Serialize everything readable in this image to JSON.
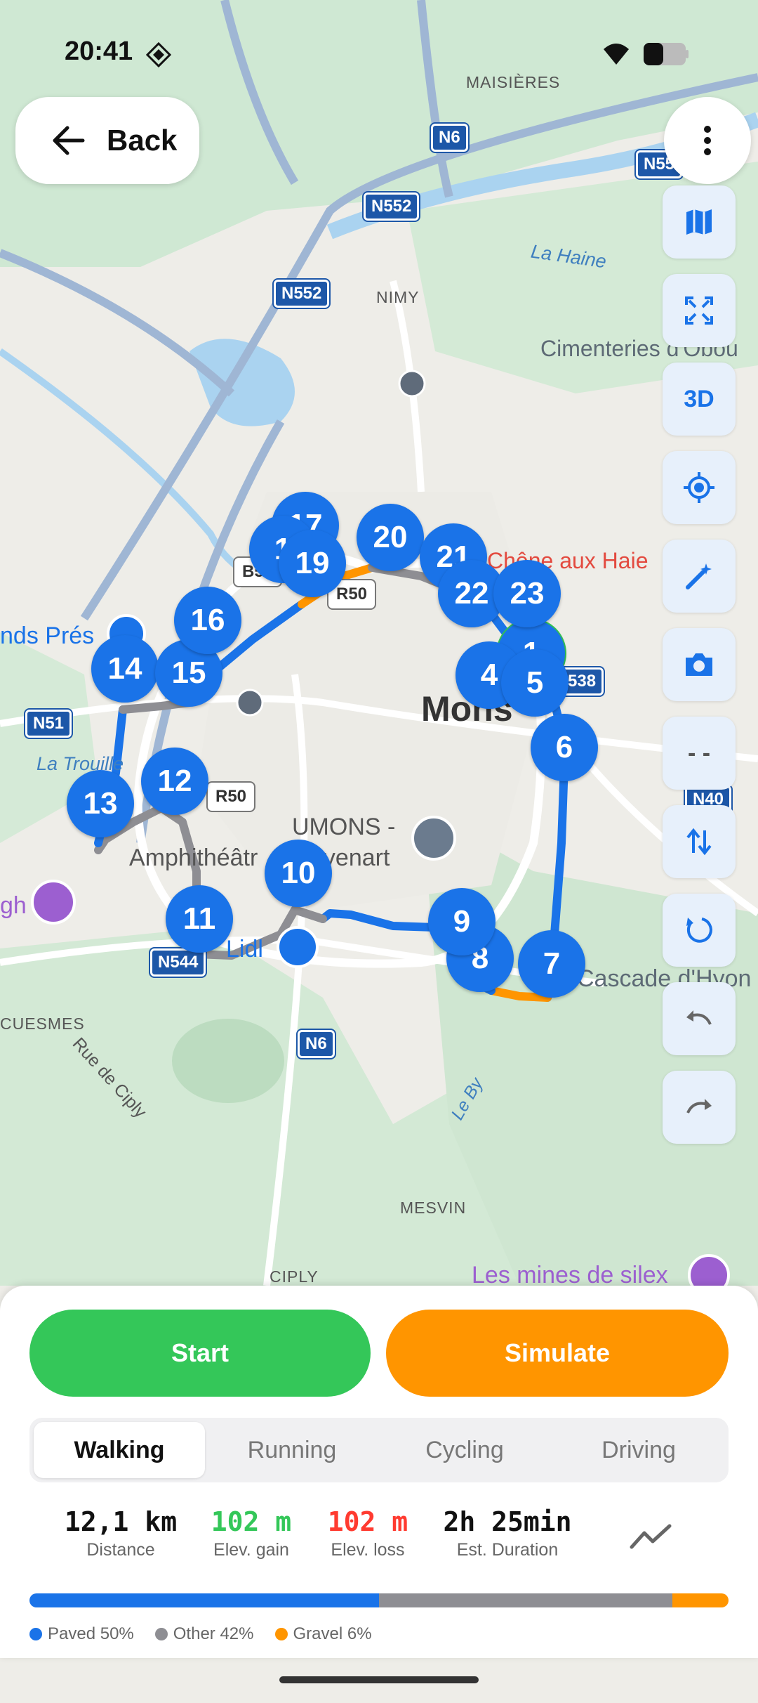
{
  "status": {
    "time": "20:41"
  },
  "header": {
    "back_label": "Back"
  },
  "tools": {
    "three_d_label": "3D",
    "dash_label": "- -"
  },
  "map": {
    "labels": {
      "maisieres": "MAISIÈRES",
      "nimy": "NIMY",
      "la_haine": "La Haine",
      "cimenteries": "Cimenteries d'Obou",
      "chene": "Chêne aux Haie",
      "mons": "Mons",
      "grands_pres": "nds Prés",
      "la_trouille": "La Trouille",
      "umons1": "UMONS -",
      "umons2": "Amphithéâtr",
      "umons3": "evenart",
      "lidl": "Lidl",
      "cuesmes": "CUESMES",
      "rue_ciply": "Rue de Ciply",
      "le_by": "Le By",
      "mesvin": "MESVIN",
      "ciply": "CIPLY",
      "mines": "Les mines de silex",
      "cascade": "Cascade d'Hyon",
      "gh": "gh"
    },
    "shields": {
      "n6a": "N6",
      "n552a": "N552",
      "n552b": "N552",
      "n55": "N55",
      "b50": "B50",
      "r50a": "R50",
      "r50b": "R50",
      "n51": "N51",
      "n544": "N544",
      "n6b": "N6",
      "r538": "538",
      "n40": "N40"
    },
    "markers": [
      "1",
      "4",
      "5",
      "6",
      "7",
      "8",
      "9",
      "10",
      "11",
      "12",
      "13",
      "14",
      "15",
      "16",
      "17",
      "1",
      "19",
      "20",
      "21",
      "22",
      "23"
    ]
  },
  "actions": {
    "start_label": "Start",
    "simulate_label": "Simulate"
  },
  "modes": {
    "tabs": [
      "Walking",
      "Running",
      "Cycling",
      "Driving"
    ],
    "active": "Walking"
  },
  "stats": {
    "distance": {
      "value": "12,1 km",
      "label": "Distance"
    },
    "elev_gain": {
      "value": "102 m",
      "label": "Elev. gain",
      "color": "#34c759"
    },
    "elev_loss": {
      "value": "102 m",
      "label": "Elev. loss",
      "color": "#ff3b30"
    },
    "duration": {
      "value": "2h 25min",
      "label": "Est. Duration"
    }
  },
  "surface": {
    "paved": {
      "label": "Paved 50%",
      "fraction": 0.5,
      "color": "#1a73e8"
    },
    "other": {
      "label": "Other 42%",
      "fraction": 0.42,
      "color": "#8e8e93"
    },
    "gravel": {
      "label": "Gravel 6%",
      "fraction": 0.06,
      "color": "#ff9500"
    }
  },
  "colors": {
    "route": "#1a73e8",
    "accent_green": "#34c759",
    "accent_orange": "#ff9500"
  }
}
